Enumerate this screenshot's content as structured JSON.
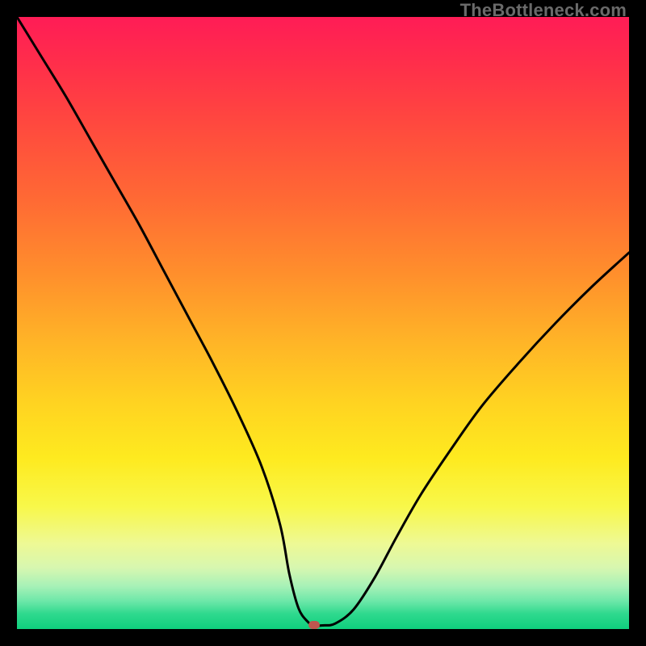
{
  "watermark": "TheBottleneck.com",
  "colors": {
    "curve": "#000000",
    "marker": "#c0564f",
    "frame": "#000000"
  },
  "chart_data": {
    "type": "line",
    "title": "",
    "xlabel": "",
    "ylabel": "",
    "xlim": [
      0,
      100
    ],
    "ylim": [
      0,
      100
    ],
    "grid": false,
    "series": [
      {
        "name": "bottleneck-curve",
        "x": [
          0,
          4,
          8,
          12,
          16,
          20,
          24,
          28,
          32,
          36,
          40,
          43,
          44.5,
          46,
          47.5,
          48.5,
          50,
          52,
          55,
          58.5,
          62,
          66,
          71,
          76,
          82,
          88,
          94,
          100
        ],
        "values": [
          100,
          93.5,
          87,
          80,
          73,
          66,
          58.5,
          51,
          43.5,
          35.5,
          26.5,
          17,
          9,
          3.4,
          1.2,
          0.6,
          0.6,
          0.9,
          3.2,
          8.5,
          15,
          22,
          29.5,
          36.5,
          43.5,
          50,
          56,
          61.5
        ]
      }
    ],
    "marker": {
      "x": 48.5,
      "y": 0.6
    }
  }
}
